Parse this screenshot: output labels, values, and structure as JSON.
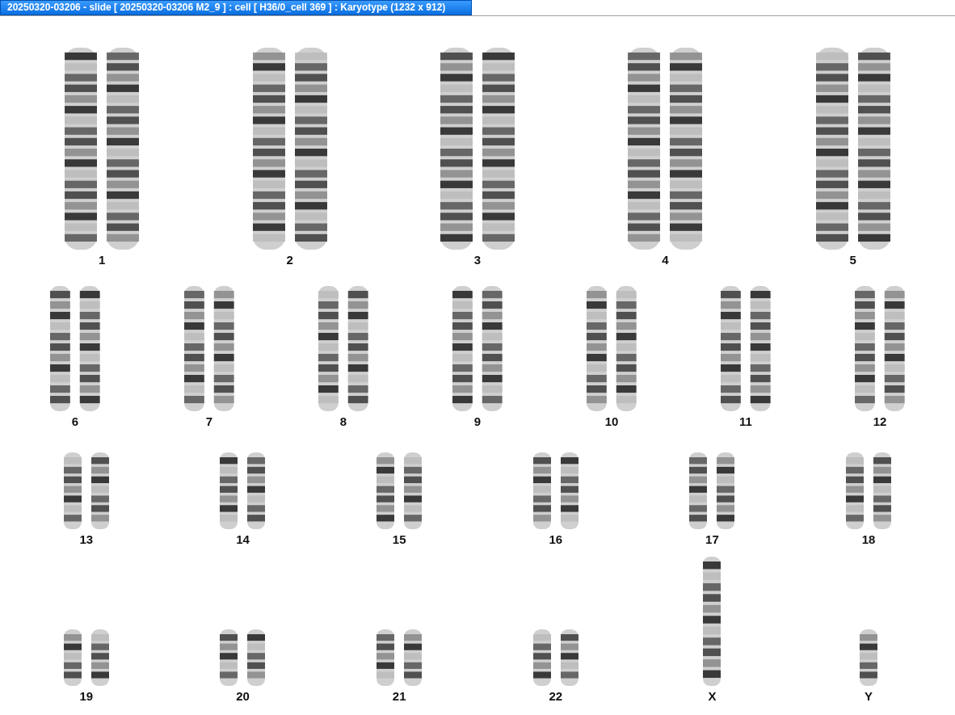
{
  "window": {
    "title": "20250320-03206 - slide [ 20250320-03206 M2_9 ] : cell [ H36/0_cell 369 ] : Karyotype  (1232 x 912)"
  },
  "karyotype": {
    "rows": [
      {
        "groups": [
          {
            "label": "1",
            "kind": "pair"
          },
          {
            "label": "2",
            "kind": "pair"
          },
          {
            "label": "3",
            "kind": "pair"
          },
          {
            "label": "4",
            "kind": "pair"
          },
          {
            "label": "5",
            "kind": "pair"
          }
        ]
      },
      {
        "groups": [
          {
            "label": "6",
            "kind": "pair"
          },
          {
            "label": "7",
            "kind": "pair"
          },
          {
            "label": "8",
            "kind": "pair"
          },
          {
            "label": "9",
            "kind": "pair"
          },
          {
            "label": "10",
            "kind": "pair"
          },
          {
            "label": "11",
            "kind": "pair"
          },
          {
            "label": "12",
            "kind": "pair"
          }
        ]
      },
      {
        "groups": [
          {
            "label": "13",
            "kind": "pair"
          },
          {
            "label": "14",
            "kind": "pair"
          },
          {
            "label": "15",
            "kind": "pair"
          },
          {
            "label": "16",
            "kind": "pair"
          },
          {
            "label": "17",
            "kind": "pair"
          },
          {
            "label": "18",
            "kind": "pair"
          }
        ]
      },
      {
        "groups": [
          {
            "label": "19",
            "kind": "pair"
          },
          {
            "label": "20",
            "kind": "pair"
          },
          {
            "label": "21",
            "kind": "pair"
          },
          {
            "label": "22",
            "kind": "pair"
          },
          {
            "label": "X",
            "kind": "long-single"
          },
          {
            "label": "Y",
            "kind": "single"
          }
        ]
      }
    ]
  }
}
